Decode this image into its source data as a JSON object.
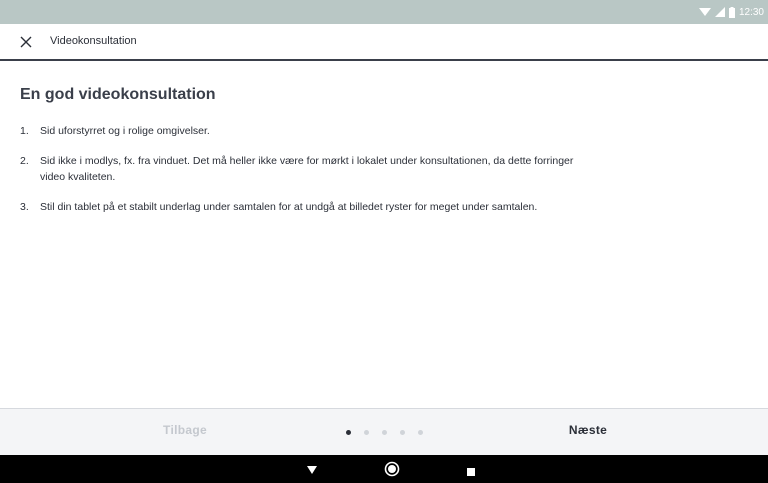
{
  "status_bar": {
    "time": "12:30"
  },
  "app_bar": {
    "title": "Videokonsultation"
  },
  "content": {
    "heading": "En god videokonsultation",
    "tips": [
      {
        "number": "1.",
        "text": "Sid uforstyrret og i rolige omgivelser."
      },
      {
        "number": "2.",
        "text": "Sid ikke i modlys, fx. fra vinduet. Det må heller ikke være for mørkt i lokalet under konsultationen, da dette forringer video kvaliteten."
      },
      {
        "number": "3.",
        "text": "Stil din tablet på et stabilt underlag under samtalen for at undgå at billedet ryster for meget under samtalen."
      }
    ]
  },
  "footer": {
    "back_label": "Tilbage",
    "next_label": "Næste",
    "pager": {
      "total": 5,
      "current": 1
    }
  },
  "colors": {
    "accent_dark": "#2b2f38",
    "status_bar": "#b9c7c5",
    "disabled_text": "#c4c8ce"
  }
}
